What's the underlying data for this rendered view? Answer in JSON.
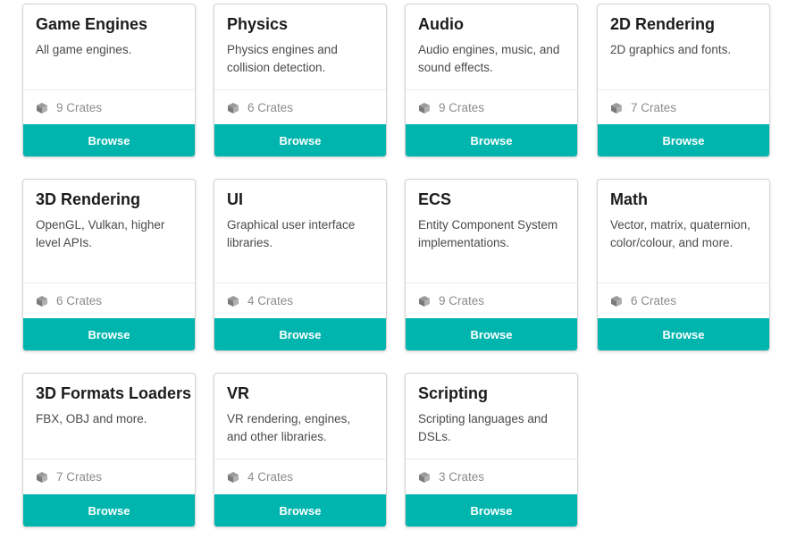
{
  "categories": [
    {
      "name": "Game Engines",
      "description": "All game engines.",
      "crates": "9 Crates",
      "button": "Browse"
    },
    {
      "name": "Physics",
      "description": "Physics engines and collision detection.",
      "crates": "6 Crates",
      "button": "Browse"
    },
    {
      "name": "Audio",
      "description": "Audio engines, music, and sound effects.",
      "crates": "9 Crates",
      "button": "Browse"
    },
    {
      "name": "2D Rendering",
      "description": "2D graphics and fonts.",
      "crates": "7 Crates",
      "button": "Browse"
    },
    {
      "name": "3D Rendering",
      "description": "OpenGL, Vulkan, higher level APIs.",
      "crates": "6 Crates",
      "button": "Browse"
    },
    {
      "name": "UI",
      "description": "Graphical user interface libraries.",
      "crates": "4 Crates",
      "button": "Browse"
    },
    {
      "name": "ECS",
      "description": "Entity Component System implementations.",
      "crates": "9 Crates",
      "button": "Browse"
    },
    {
      "name": "Math",
      "description": "Vector, matrix, quaternion, color/colour, and more.",
      "crates": "6 Crates",
      "button": "Browse"
    },
    {
      "name": "3D Formats Loaders",
      "description": "FBX, OBJ and more.",
      "crates": "7 Crates",
      "button": "Browse"
    },
    {
      "name": "VR",
      "description": "VR rendering, engines, and other libraries.",
      "crates": "4 Crates",
      "button": "Browse"
    },
    {
      "name": "Scripting",
      "description": "Scripting languages and DSLs.",
      "crates": "3 Crates",
      "button": "Browse"
    }
  ],
  "icons": {
    "crate": "cube-icon"
  },
  "colors": {
    "accent": "#00b5ad",
    "title": "#1b1c1d",
    "muted": "#8c8c8c"
  }
}
